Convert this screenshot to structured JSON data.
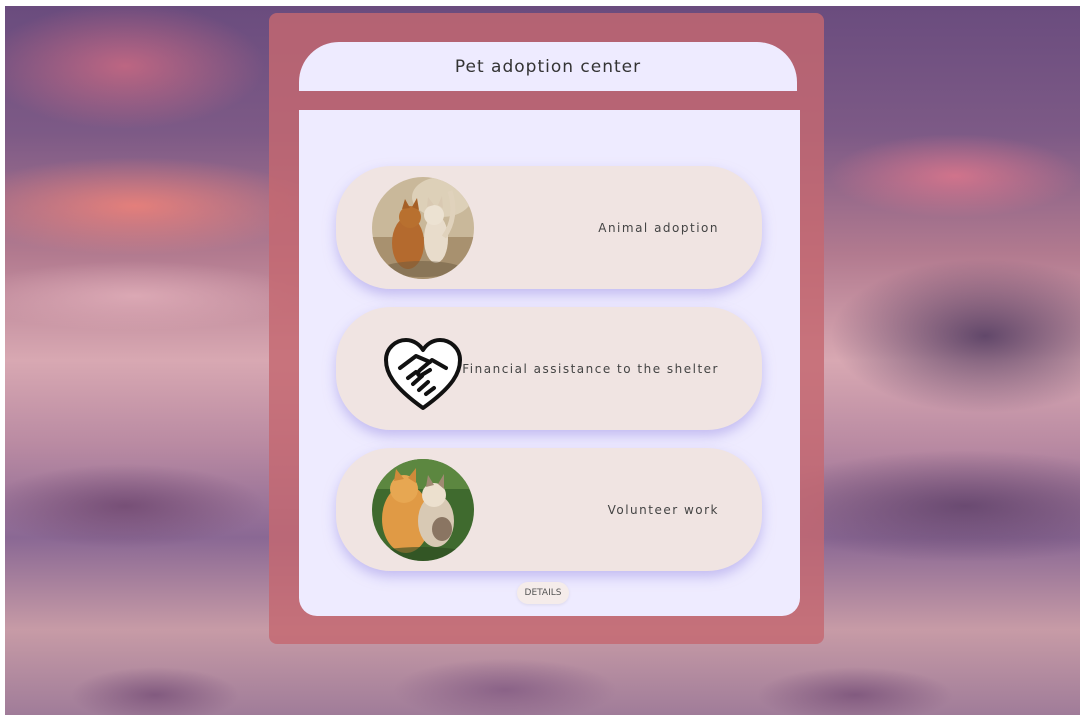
{
  "header": {
    "title": "Pet adoption center"
  },
  "options": [
    {
      "label": "Animal adoption",
      "icon": "cats-photo"
    },
    {
      "label": "Financial assistance to the shelter",
      "icon": "handshake-heart-icon"
    },
    {
      "label": "Volunteer work",
      "icon": "cats-photo"
    }
  ],
  "details": {
    "label": "DETAILS"
  },
  "colors": {
    "panel": "#c46870",
    "card": "#eeebff",
    "option": "#f0e4e2"
  }
}
